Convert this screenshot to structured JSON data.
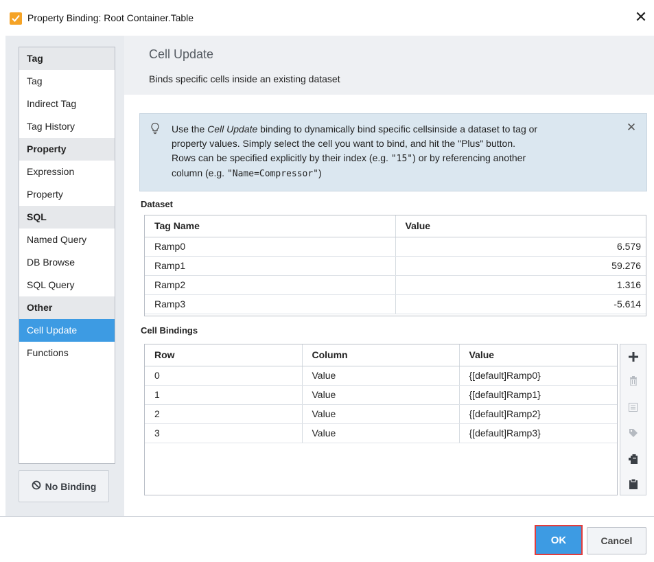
{
  "window": {
    "title": "Property Binding: Root Container.Table",
    "app_icon": "ignition-designer-icon",
    "close_glyph": "✕"
  },
  "nav": {
    "groups": [
      {
        "category": "Tag",
        "items": [
          "Tag",
          "Indirect Tag",
          "Tag History"
        ]
      },
      {
        "category": "Property",
        "items": [
          "Expression",
          "Property"
        ]
      },
      {
        "category": "SQL",
        "items": [
          "Named Query",
          "DB Browse",
          "SQL Query"
        ]
      },
      {
        "category": "Other",
        "items": [
          "Cell Update",
          "Functions"
        ]
      }
    ],
    "selected": "Cell Update",
    "no_binding_label": "No Binding"
  },
  "header": {
    "title": "Cell Update",
    "subtitle": "Binds specific cells inside an existing dataset"
  },
  "info": {
    "line1_pre": "Use the ",
    "line1_em": "Cell Update",
    "line1_post": " binding to dynamically bind specific cellsinside a dataset to tag or",
    "line2": "property values. Simply select the cell you want to bind, and hit the \"Plus\" button.",
    "line3_pre": "Rows can be specified explicitly by their index (e.g. ",
    "line3_code": "\"15\"",
    "line3_post": ") or by referencing another",
    "line4_pre": "column (e.g. ",
    "line4_code": "\"Name=Compressor\"",
    "line4_post": ")"
  },
  "dataset": {
    "label": "Dataset",
    "columns": [
      "Tag Name",
      "Value"
    ],
    "rows": [
      [
        "Ramp0",
        "6.579"
      ],
      [
        "Ramp1",
        "59.276"
      ],
      [
        "Ramp2",
        "1.316"
      ],
      [
        "Ramp3",
        "-5.614"
      ]
    ]
  },
  "cell_bindings": {
    "label": "Cell Bindings",
    "columns": [
      "Row",
      "Column",
      "Value"
    ],
    "rows": [
      [
        "0",
        "Value",
        "{[default]Ramp0}"
      ],
      [
        "1",
        "Value",
        "{[default]Ramp1}"
      ],
      [
        "2",
        "Value",
        "{[default]Ramp2}"
      ],
      [
        "3",
        "Value",
        "{[default]Ramp3}"
      ]
    ],
    "tools": [
      "add-icon",
      "delete-icon",
      "edit-icon",
      "tag-icon",
      "paste-tag-icon",
      "clipboard-icon"
    ]
  },
  "footer": {
    "ok_label": "OK",
    "cancel_label": "Cancel"
  },
  "colors": {
    "accent": "#3d9be3",
    "ok_outline": "#e23c3c",
    "info_bg": "#dbe7f0"
  }
}
